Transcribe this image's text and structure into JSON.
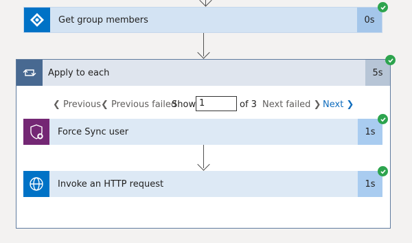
{
  "steps": {
    "get_group_members": {
      "title": "Get group members",
      "duration": "0s"
    },
    "apply_to_each": {
      "title": "Apply to each",
      "duration": "5s"
    },
    "force_sync_user": {
      "title": "Force Sync user",
      "duration": "1s"
    },
    "invoke_http": {
      "title": "Invoke an HTTP request",
      "duration": "1s"
    }
  },
  "pager": {
    "previous": "Previous",
    "previous_failed": "Previous failed",
    "show": "Show",
    "current": "1",
    "of_total": "of 3",
    "next_failed": "Next failed",
    "next": "Next"
  },
  "colors": {
    "success": "#2da44e",
    "azure_ad": "#0072c6",
    "apply_header": "#dfe5ee",
    "force_sync_icon": "#742774",
    "http_icon": "#0072c6",
    "accent": "#0f6cbd"
  },
  "icons": [
    "azure-ad-icon",
    "loop-icon",
    "shield-user-icon",
    "globe-icon",
    "success-check-icon",
    "arrow-down-icon"
  ]
}
